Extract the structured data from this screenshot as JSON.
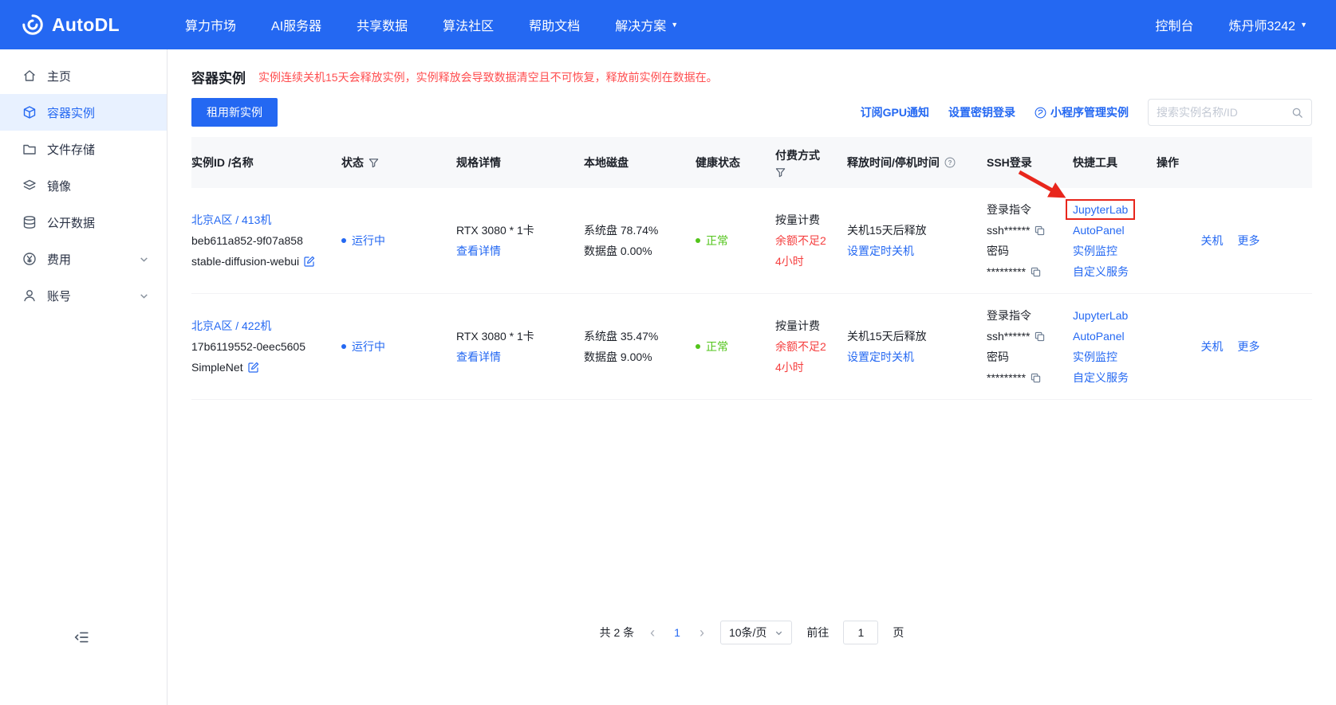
{
  "navbar": {
    "brand": "AutoDL",
    "items": [
      "算力市场",
      "AI服务器",
      "共享数据",
      "算法社区",
      "帮助文档",
      "解决方案"
    ],
    "console": "控制台",
    "user": "炼丹师3242"
  },
  "sidebar": {
    "items": [
      {
        "label": "主页"
      },
      {
        "label": "容器实例"
      },
      {
        "label": "文件存储"
      },
      {
        "label": "镜像"
      },
      {
        "label": "公开数据"
      },
      {
        "label": "费用"
      },
      {
        "label": "账号"
      }
    ]
  },
  "page": {
    "title": "容器实例",
    "warning": "实例连续关机15天会释放实例，实例释放会导致数据清空且不可恢复，释放前实例在数据在。",
    "rent_button": "租用新实例",
    "gpu_notify_link": "订阅GPU通知",
    "ssh_key_link": "设置密钥登录",
    "miniprogram_link": "小程序管理实例",
    "search_placeholder": "搜索实例名称/ID"
  },
  "table": {
    "headers": {
      "id_name": "实例ID /名称",
      "status": "状态",
      "spec": "规格详情",
      "disk": "本地磁盘",
      "health": "健康状态",
      "billing": "付费方式",
      "release": "释放时间/停机时间",
      "ssh": "SSH登录",
      "tools": "快捷工具",
      "actions": "操作"
    },
    "rows": [
      {
        "region": "北京A区 / 413机",
        "uid": "beb611a852-9f07a858",
        "name": "stable-diffusion-webui",
        "status": "运行中",
        "gpu": "RTX 3080 * 1卡",
        "detail_link": "查看详情",
        "sys_disk": "系统盘 78.74%",
        "data_disk": "数据盘 0.00%",
        "health": "正常",
        "billing": "按量计费",
        "billing_warn_line1": "余额不足2",
        "billing_warn_line2": "4小时",
        "release": "关机15天后释放",
        "schedule_link": "设置定时关机",
        "ssh_cmd_label": "登录指令",
        "ssh_cmd": "ssh******",
        "ssh_pwd_label": "密码",
        "ssh_pwd": "*********",
        "tools": [
          "JupyterLab",
          "AutoPanel",
          "实例监控",
          "自定义服务"
        ],
        "action_shutdown": "关机",
        "action_more": "更多"
      },
      {
        "region": "北京A区 / 422机",
        "uid": "17b6119552-0eec5605",
        "name": "SimpleNet",
        "status": "运行中",
        "gpu": "RTX 3080 * 1卡",
        "detail_link": "查看详情",
        "sys_disk": "系统盘 35.47%",
        "data_disk": "数据盘 9.00%",
        "health": "正常",
        "billing": "按量计费",
        "billing_warn_line1": "余额不足2",
        "billing_warn_line2": "4小时",
        "release": "关机15天后释放",
        "schedule_link": "设置定时关机",
        "ssh_cmd_label": "登录指令",
        "ssh_cmd": "ssh******",
        "ssh_pwd_label": "密码",
        "ssh_pwd": "*********",
        "tools": [
          "JupyterLab",
          "AutoPanel",
          "实例监控",
          "自定义服务"
        ],
        "action_shutdown": "关机",
        "action_more": "更多"
      }
    ]
  },
  "pagination": {
    "total": "共 2 条",
    "current_page": "1",
    "page_size": "10条/页",
    "goto_label": "前往",
    "goto_value": "1",
    "page_unit": "页"
  },
  "colors": {
    "primary_blue": "#2468f2",
    "warning_red": "#ff4d4f",
    "danger_red": "#f53f3f",
    "success_green": "#52c41a",
    "annotation_red": "#e8261c"
  }
}
